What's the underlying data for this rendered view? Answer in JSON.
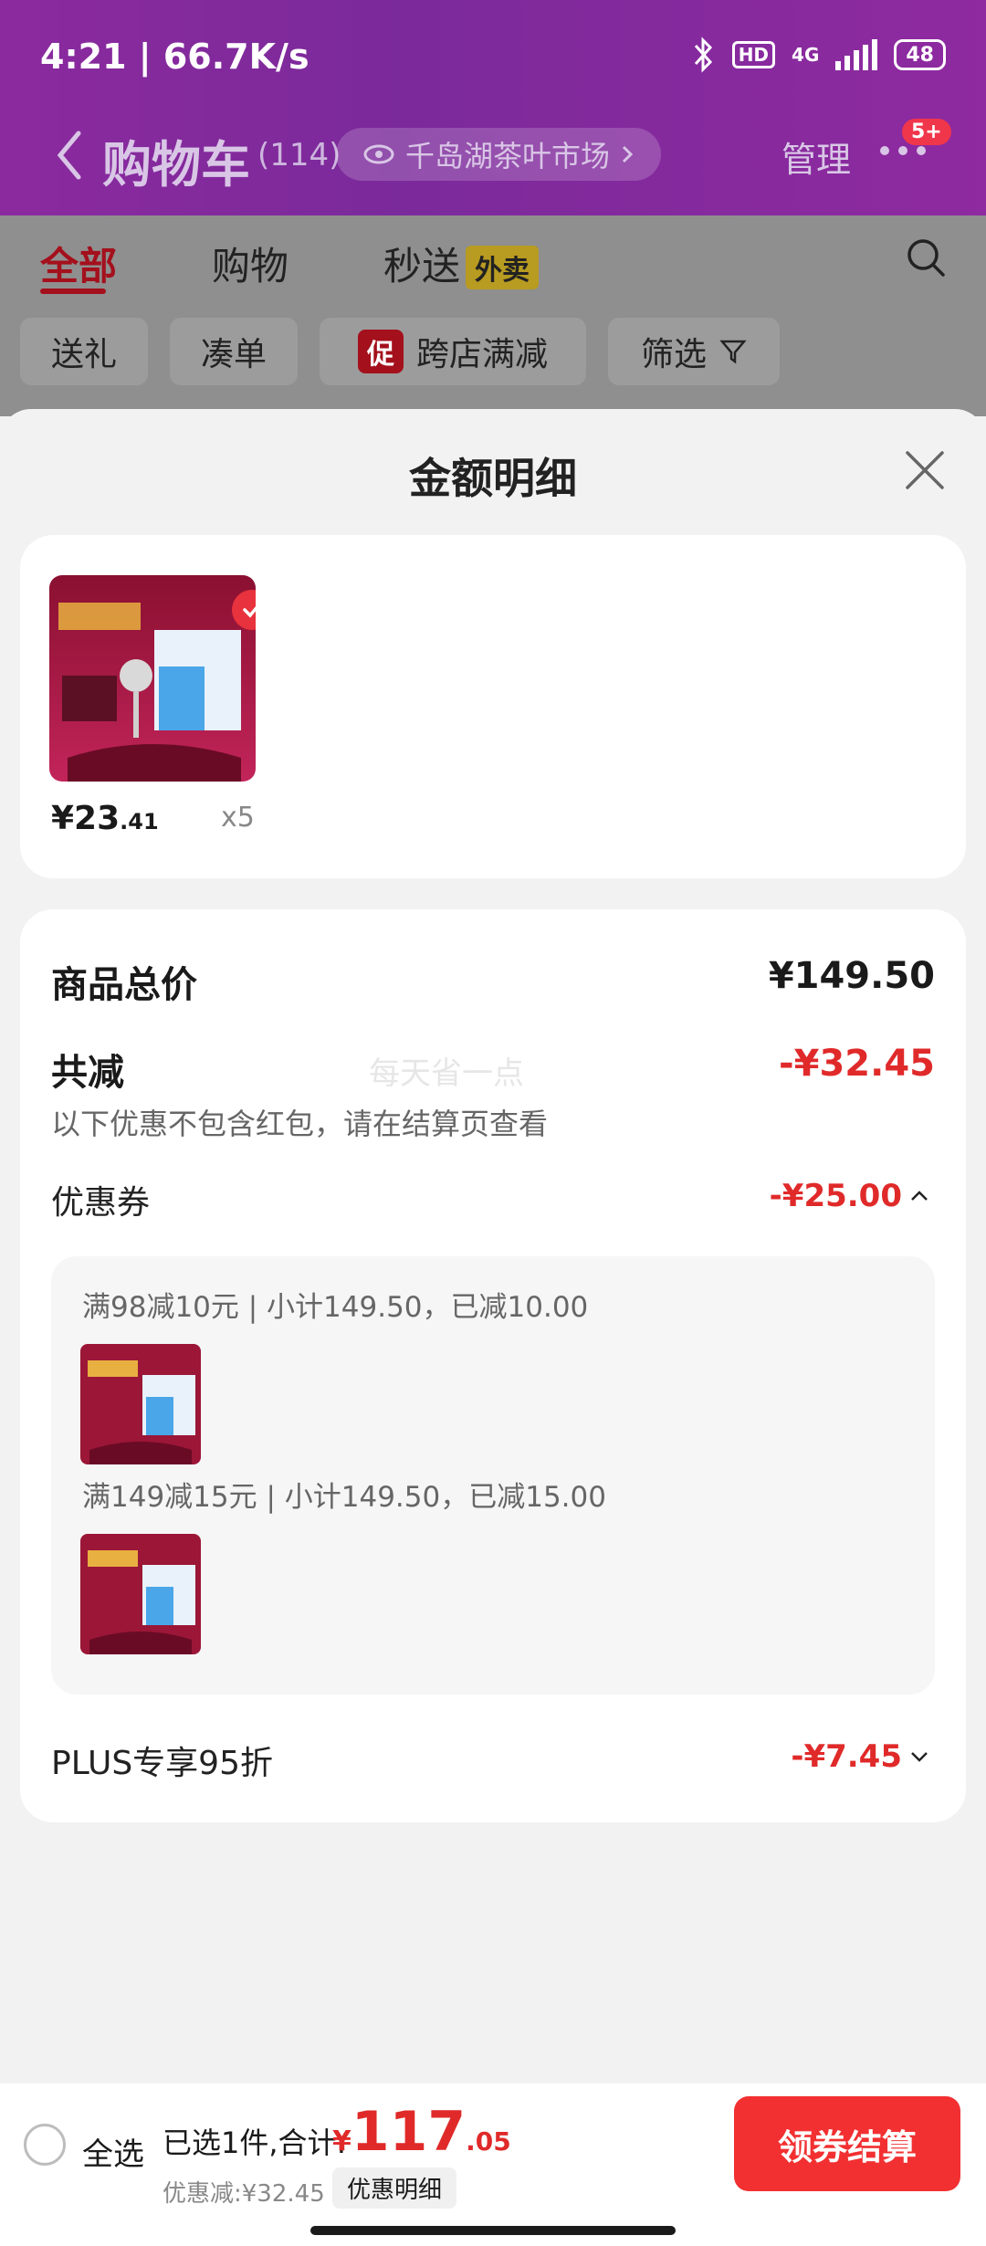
{
  "status_bar": {
    "time_speed": "4:21 | 66.7K/s",
    "net": "4G",
    "battery": "48"
  },
  "header": {
    "title": "购物车",
    "count": "(114)",
    "store_chip": "千岛湖茶叶市场",
    "manage": "管理",
    "badge": "5+"
  },
  "tabs": [
    {
      "label": "全部"
    },
    {
      "label": "购物"
    },
    {
      "label": "秒送"
    }
  ],
  "takeout_tag": "外卖",
  "filters": {
    "gift": "送礼",
    "bundle": "凑单",
    "promo_tag": "促",
    "cross_store": "跨店满减",
    "filter": "筛选"
  },
  "sheet": {
    "title": "金额明细",
    "product": {
      "price_main": "¥23",
      "price_cents": ".41",
      "qty": "x5"
    },
    "total_label": "商品总价",
    "total_value": "¥149.50",
    "reduce_label": "共减",
    "reduce_value": "-¥32.45",
    "watermark": "每天省一点",
    "note": "以下优惠不包含红包，请在结算页查看",
    "coupon_label": "优惠券",
    "coupon_value": "-¥25.00",
    "coupon_lines": [
      "满98减10元 | 小计149.50，已减10.00",
      "满149减15元 | 小计149.50，已减15.00"
    ],
    "plus_label": "PLUS专享95折",
    "plus_value": "-¥7.45"
  },
  "bottom_bar": {
    "select_all": "全选",
    "summary": "已选1件,合计:",
    "total_yen": "¥",
    "total_main": "117",
    "total_cents": ".05",
    "discount": "优惠减:¥32.45",
    "detail_chip": "优惠明细",
    "checkout": "领券结算"
  },
  "colors": {
    "accent_red": "#e02a2a",
    "header_purple": "#7b2a9b",
    "checkout": "#f23031"
  }
}
